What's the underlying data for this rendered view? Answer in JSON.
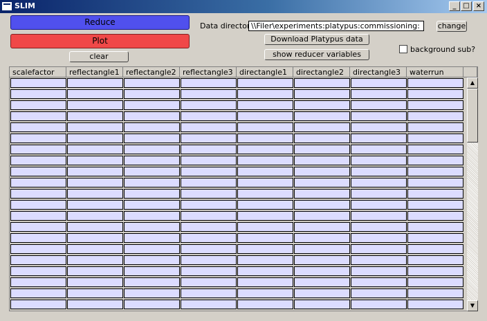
{
  "window": {
    "title": "SLIM"
  },
  "controls": {
    "reduce_label": "Reduce",
    "plot_label": "Plot",
    "clear_label": "clear",
    "datadir_label": "Data directory",
    "datadir_value": "\\\\Filer\\experiments:platypus:commissioning:",
    "change_label": "change",
    "download_label": "Download Platypus data",
    "showvars_label": "show reducer variables",
    "bgsub_label": "background sub?",
    "bgsub_checked": false
  },
  "table": {
    "columns": [
      "scalefactor",
      "reflectangle1",
      "reflectangle2",
      "reflectangle3",
      "directangle1",
      "directangle2",
      "directangle3",
      "waterrun"
    ],
    "visible_rows": 21
  },
  "colors": {
    "reduce_button": "#5050ee",
    "plot_button": "#f04848",
    "cell_background": "#dcdcff"
  },
  "icons": {
    "minimize": "minimize-icon",
    "maximize": "maximize-icon",
    "close": "close-icon",
    "scroll_up": "arrow-up-icon",
    "scroll_down": "arrow-down-icon"
  }
}
